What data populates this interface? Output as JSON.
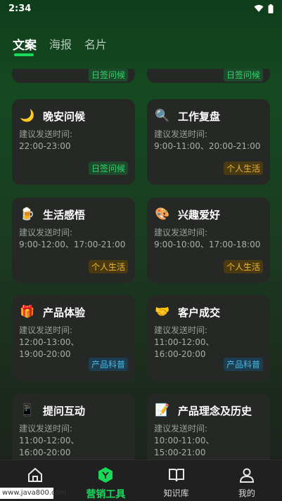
{
  "status": {
    "time": "2:34"
  },
  "tabs": [
    {
      "label": "文案",
      "active": true
    },
    {
      "label": "海报",
      "active": false
    },
    {
      "label": "名片",
      "active": false
    }
  ],
  "partial_tags": [
    "日签问候",
    "日签问候"
  ],
  "hint_label": "建议发送时间:",
  "cards": [
    {
      "icon": "moon-icon",
      "emoji": "🌙",
      "title": "晚安问候",
      "times": "22:00-23:00",
      "tag": "日签问候",
      "tag_color": "green"
    },
    {
      "icon": "magnifier-icon",
      "emoji": "🔍",
      "title": "工作复盘",
      "times": "9:00-11:00、20:00-21:00",
      "tag": "个人生活",
      "tag_color": "yellow"
    },
    {
      "icon": "cup-icon",
      "emoji": "🍺",
      "title": "生活感悟",
      "times": "9:00-12:00、17:00-21:00",
      "tag": "个人生活",
      "tag_color": "yellow"
    },
    {
      "icon": "palette-icon",
      "emoji": "🎨",
      "title": "兴趣爱好",
      "times": "9:00-10:00、17:00-18:00",
      "tag": "个人生活",
      "tag_color": "yellow"
    },
    {
      "icon": "gift-icon",
      "emoji": "🎁",
      "title": "产品体验",
      "times": "12:00-13:00、\n19:00-20:00",
      "tag": "产品科普",
      "tag_color": "blue"
    },
    {
      "icon": "handshake-icon",
      "emoji": "🤝",
      "title": "客户成交",
      "times": "11:00-12:00、\n16:00-20:00",
      "tag": "产品科普",
      "tag_color": "blue"
    },
    {
      "icon": "phone-card-icon",
      "emoji": "📱",
      "title": "提问互动",
      "times": "11:00-12:00、\n16:00-20:00",
      "tag": "",
      "tag_color": "blue"
    },
    {
      "icon": "note-icon",
      "emoji": "📝",
      "title": "产品理念及历史",
      "times": "10:00-11:00、\n15:00-21:00",
      "tag": "",
      "tag_color": "yellow"
    }
  ],
  "nav": [
    {
      "label": "",
      "icon": "home-icon",
      "active": false
    },
    {
      "label": "营销工具",
      "icon": "marketing-tools-icon",
      "active": true
    },
    {
      "label": "知识库",
      "icon": "book-icon",
      "active": false
    },
    {
      "label": "我的",
      "icon": "user-icon",
      "active": false
    }
  ],
  "watermark": "www.java800.com",
  "colors": {
    "accent": "#19d95a",
    "card_bg": "#262826"
  }
}
